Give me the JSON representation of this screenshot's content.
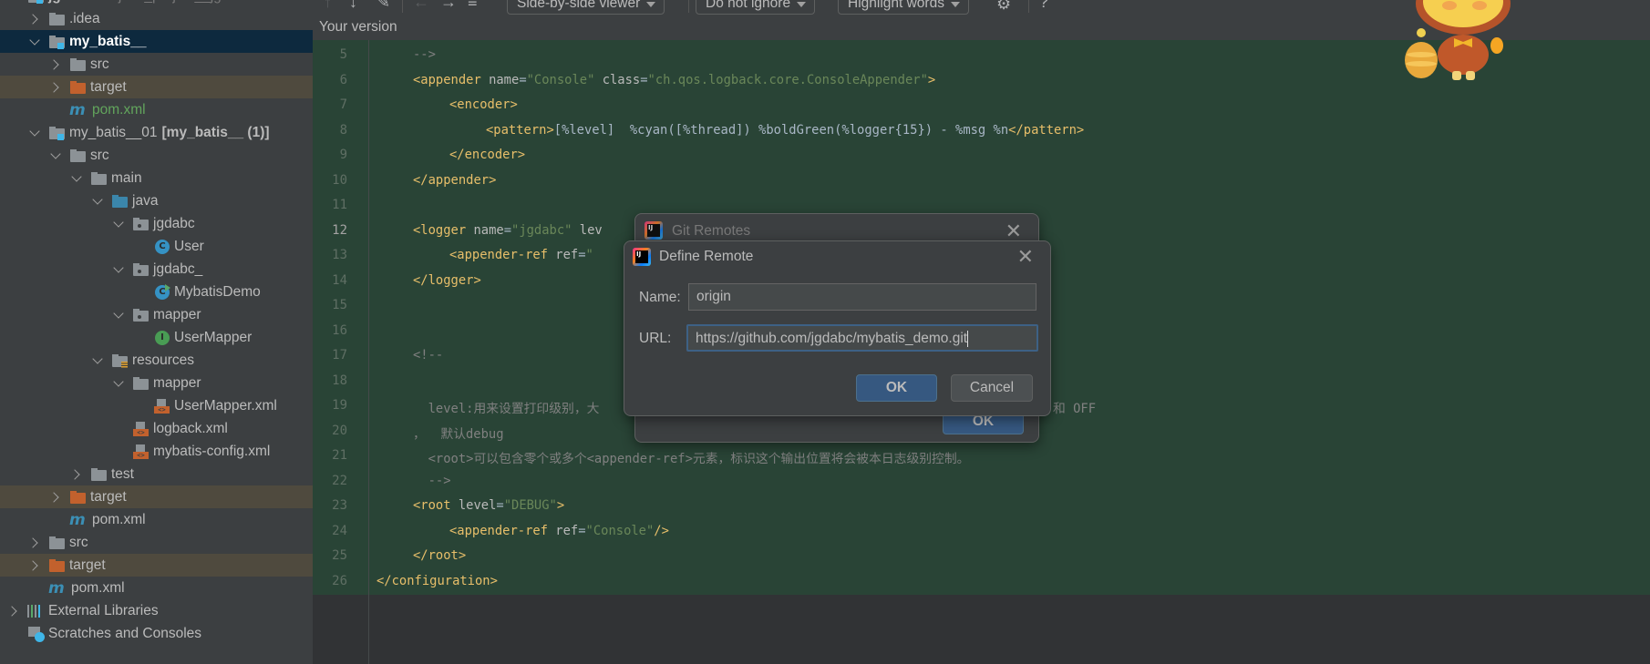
{
  "sidebar": {
    "root": {
      "label": "jgdabc",
      "path": "E:\\java_project__jgdabc"
    },
    "items": [
      {
        "label": "jgdabc",
        "level": -1,
        "chev": "down",
        "icon": "module",
        "bold": true,
        "sub": "E:\\java_project__jgdabc"
      },
      {
        "label": ".idea",
        "level": 0,
        "chev": "right",
        "icon": "folder"
      },
      {
        "label": "my_batis__",
        "level": 0,
        "chev": "down",
        "icon": "module",
        "boldlabel": true,
        "state": "selected"
      },
      {
        "label": "src",
        "level": 1,
        "chev": "right",
        "icon": "folder"
      },
      {
        "label": "target",
        "level": 1,
        "chev": "right",
        "icon": "folder orange",
        "state": "excluded"
      },
      {
        "label": "pom.xml",
        "level": 1,
        "icon": "maven",
        "state": "green"
      },
      {
        "label": "my_batis__01",
        "level": 0,
        "chev": "down",
        "icon": "module",
        "extra": "[my_batis__ (1)]"
      },
      {
        "label": "src",
        "level": 1,
        "chev": "down",
        "icon": "folder"
      },
      {
        "label": "main",
        "level": 2,
        "chev": "down",
        "icon": "folder"
      },
      {
        "label": "java",
        "level": 3,
        "chev": "down",
        "icon": "folder blue"
      },
      {
        "label": "jgdabc",
        "level": 4,
        "chev": "down",
        "icon": "pkg"
      },
      {
        "label": "User",
        "level": 5,
        "icon": "cls"
      },
      {
        "label": "jgdabc_",
        "level": 4,
        "chev": "down",
        "icon": "pkg"
      },
      {
        "label": "MybatisDemo",
        "level": 5,
        "icon": "cls run"
      },
      {
        "label": "mapper",
        "level": 4,
        "chev": "down",
        "icon": "pkg"
      },
      {
        "label": "UserMapper",
        "level": 5,
        "icon": "cls iface"
      },
      {
        "label": "resources",
        "level": 3,
        "chev": "down",
        "icon": "res"
      },
      {
        "label": "mapper",
        "level": 4,
        "chev": "down",
        "icon": "folder"
      },
      {
        "label": "UserMapper.xml",
        "level": 5,
        "icon": "xml"
      },
      {
        "label": "logback.xml",
        "level": 4,
        "icon": "xml"
      },
      {
        "label": "mybatis-config.xml",
        "level": 4,
        "icon": "xml"
      },
      {
        "label": "test",
        "level": 2,
        "chev": "right",
        "icon": "folder"
      },
      {
        "label": "target",
        "level": 1,
        "chev": "right",
        "icon": "folder orange",
        "state": "excluded"
      },
      {
        "label": "pom.xml",
        "level": 1,
        "icon": "maven"
      },
      {
        "label": "src",
        "level": 0,
        "chev": "right",
        "icon": "folder"
      },
      {
        "label": "target",
        "level": 0,
        "chev": "right",
        "icon": "folder orange",
        "state": "excluded"
      },
      {
        "label": "pom.xml",
        "level": 0,
        "icon": "maven"
      },
      {
        "label": "External Libraries",
        "level": -1,
        "chev": "right",
        "icon": "libs"
      },
      {
        "label": "Scratches and Consoles",
        "level": -1,
        "icon": "scratch"
      }
    ]
  },
  "toolbar": {
    "viewer": "Side-by-side viewer",
    "whitespace": "Do not ignore",
    "highlight": "Highlight words",
    "help": "?"
  },
  "editor": {
    "header": "Your version",
    "current_line": 12,
    "lines": [
      {
        "n": 5,
        "i": 1,
        "s": [
          [
            "c",
            "-->"
          ]
        ]
      },
      {
        "n": 6,
        "i": 1,
        "s": [
          [
            "t",
            "<appender"
          ],
          [
            "a",
            " name"
          ],
          [
            "x",
            "="
          ],
          [
            "v",
            "\"Console\""
          ],
          [
            "a",
            " class"
          ],
          [
            "x",
            "="
          ],
          [
            "v",
            "\"ch.qos.logback.core.ConsoleAppender\""
          ],
          [
            "t",
            ">"
          ]
        ]
      },
      {
        "n": 7,
        "i": 2,
        "s": [
          [
            "t",
            "<encoder>"
          ]
        ]
      },
      {
        "n": 8,
        "i": 3,
        "s": [
          [
            "t",
            "<pattern>"
          ],
          [
            "x",
            "[%level]  %cyan([%thread]) %boldGreen(%logger{15}) - %msg %n"
          ],
          [
            "t",
            "</pattern>"
          ]
        ]
      },
      {
        "n": 9,
        "i": 2,
        "s": [
          [
            "t",
            "</encoder>"
          ]
        ]
      },
      {
        "n": 10,
        "i": 1,
        "s": [
          [
            "t",
            "</appender>"
          ]
        ]
      },
      {
        "n": 11,
        "i": 0,
        "s": []
      },
      {
        "n": 12,
        "i": 1,
        "s": [
          [
            "t",
            "<logger"
          ],
          [
            "a",
            " name"
          ],
          [
            "x",
            "="
          ],
          [
            "v",
            "\"jgdabc\""
          ],
          [
            "a",
            " lev"
          ]
        ]
      },
      {
        "n": 13,
        "i": 2,
        "s": [
          [
            "t",
            "<appender-ref"
          ],
          [
            "a",
            " ref"
          ],
          [
            "x",
            "="
          ],
          [
            "v",
            "\""
          ]
        ]
      },
      {
        "n": 14,
        "i": 1,
        "s": [
          [
            "t",
            "</logger>"
          ]
        ]
      },
      {
        "n": 15,
        "i": 0,
        "s": []
      },
      {
        "n": 16,
        "i": 0,
        "s": []
      },
      {
        "n": 17,
        "i": 1,
        "s": [
          [
            "c",
            "<!--"
          ]
        ]
      },
      {
        "n": 18,
        "i": 0,
        "s": []
      },
      {
        "n": 19,
        "i": 1,
        "s": [
          [
            "c",
            "  level:用来设置打印级别，大"
          ]
        ],
        "tail": "和 OFF"
      },
      {
        "n": 20,
        "i": 1,
        "s": [
          [
            "c",
            "，  默认debug"
          ]
        ]
      },
      {
        "n": 21,
        "i": 1,
        "s": [
          [
            "c",
            "  <root>可以包含零个或多个<appender-ref>元素，标识这个输出位置将会被本日志级别控制。"
          ]
        ]
      },
      {
        "n": 22,
        "i": 1,
        "s": [
          [
            "c",
            "  -->"
          ]
        ]
      },
      {
        "n": 23,
        "i": 1,
        "s": [
          [
            "t",
            "<root"
          ],
          [
            "a",
            " level"
          ],
          [
            "x",
            "="
          ],
          [
            "v",
            "\"DEBUG\""
          ],
          [
            "t",
            ">"
          ]
        ]
      },
      {
        "n": 24,
        "i": 2,
        "s": [
          [
            "t",
            "<appender-ref"
          ],
          [
            "a",
            " ref"
          ],
          [
            "x",
            "="
          ],
          [
            "v",
            "\"Console\""
          ],
          [
            "t",
            "/>"
          ]
        ]
      },
      {
        "n": 25,
        "i": 1,
        "s": [
          [
            "t",
            "</root>"
          ]
        ]
      },
      {
        "n": 26,
        "i": 0,
        "s": [
          [
            "t",
            "</configuration>"
          ]
        ]
      }
    ]
  },
  "git_remotes_dialog": {
    "title": "Git Remotes",
    "ok": "OK"
  },
  "define_remote_dialog": {
    "title": "Define Remote",
    "name_label": "Name:",
    "name_value": "origin",
    "url_label": "URL:",
    "url_value": "https://github.com/jgdabc/mybatis_demo.git",
    "ok": "OK",
    "cancel": "Cancel"
  }
}
